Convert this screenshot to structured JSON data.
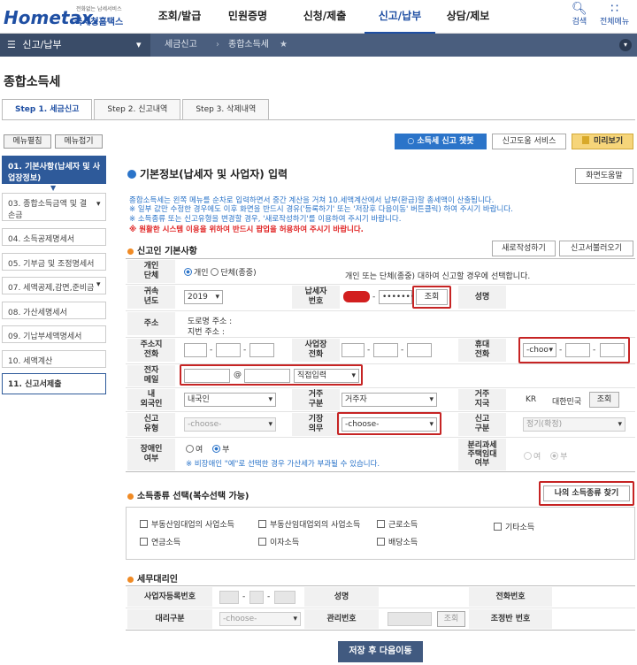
{
  "header": {
    "logo_brand": "Hometax.",
    "logo_sub": "국세청홈택스",
    "logo_tiny": "전화없는 납세서비스",
    "gnb": [
      "조회/발급",
      "민원증명",
      "신청/제출",
      "신고/납부",
      "상담/제보"
    ],
    "search_label": "검색",
    "allmenu_label": "전체메뉴"
  },
  "navbar": {
    "menu_label": "신고/납부",
    "crumb1": "세금신고",
    "crumb2": "종합소득세"
  },
  "page_title": "종합소득세",
  "steps": [
    "Step 1. 세금신고",
    "Step 2. 신고내역",
    "Step 3. 삭제내역"
  ],
  "side": {
    "expand_label": "메뉴펼침",
    "collapse_label": "메뉴접기",
    "items": [
      "01. 기본사항(납세자 및 사업장정보)",
      "03. 종합소득금액 및 결손금",
      "04. 소득공제명세서",
      "05. 기부금 및 조정명세서",
      "07. 세액공제,감면,준비금",
      "08. 가산세명세서",
      "09. 기납부세액명세서",
      "10. 세액계산",
      "11. 신고서제출"
    ]
  },
  "top_buttons": {
    "chatbot": "소득세 신고 챗봇",
    "help_service": "신고도움 서비스",
    "preview": "미리보기"
  },
  "main": {
    "title": "기본정보(납세자 및 사업자) 입력",
    "screen_help": "화면도움말",
    "notes": [
      "종합소득세는 왼쪽 메뉴를 순차로 입력하면서 중간 계산을 거쳐 10.세액계산에서 납부(환급)할 총세액이 산출됩니다.",
      "※ 일부 값만 수정한 경우에도 이후 화면을 반드시 경유('등록하기' 또는 '저장후 다음이동' 버튼클릭) 하여 주시기 바랍니다.",
      "※ 소득종류 또는 신고유형을 변경할 경우, '새로작성하기'를 이용하여 주시기 바랍니다."
    ],
    "note_red": "※ 원활한 시스템 이용을 위하여 반드시 팝업을 허용하여 주시기 바랍니다."
  },
  "basic": {
    "section_title": "신고인 기본사항",
    "new_write": "새로작성하기",
    "load_report": "신고서불러오기",
    "individual_label": "개인\n단체",
    "radio_individual": "개인",
    "radio_group": "단체(종중)",
    "individual_desc": "개인 또는 단체(종중) 대하여 신고할 경우에 선택합니다.",
    "year_label": "귀속\n년도",
    "year_value": "2019",
    "taxpayer_no_label": "납세자\n번호",
    "taxpayer_no_mask": "•••••••",
    "lookup": "조회",
    "name_label": "성명",
    "address_label": "주소",
    "road_address": "도로명 주소 :",
    "lot_address": "지번 주소 :",
    "home_phone_label": "주소지\n전화",
    "biz_phone_label": "사업장\n전화",
    "mobile_label": "휴대\n전화",
    "mobile_select": "-choo",
    "email_label": "전자\n메일",
    "email_at": "@",
    "email_select": "직접입력",
    "residence_label": "내\n외국인",
    "residence_value": "내국인",
    "resident_type_label": "거주\n구분",
    "resident_type_value": "거주자",
    "resident_country_label": "거주\n지국",
    "country_code": "KR",
    "country_name": "대한민국",
    "report_type_label": "신고\n유형",
    "report_type_value": "-choose-",
    "filing_duty_label": "기장\n의무",
    "filing_duty_value": "-choose-",
    "report_class_label": "신고\n구분",
    "report_class_value": "정기(확정)",
    "disabled_label": "장애인\n여부",
    "yes": "여",
    "no": "부",
    "disabled_note": "※ 비장애인 \"예\"로 선택한 경우 가산세가 부과될 수 있습니다.",
    "separate_label": "분리과세\n주택임대\n여부"
  },
  "income": {
    "section_title": "소득종류 선택(복수선택 가능)",
    "find_button": "나의 소득종류 찾기",
    "options": [
      "부동산임대업의 사업소득",
      "부동산임대업외의 사업소득",
      "근로소득",
      "기타소득",
      "연금소득",
      "이자소득",
      "배당소득"
    ]
  },
  "agent": {
    "section_title": "세무대리인",
    "biz_no_label": "사업자등록번호",
    "name_label": "성명",
    "phone_label": "전화번호",
    "type_label": "대리구분",
    "type_value": "-choose-",
    "manage_no_label": "관리번호",
    "lookup": "조회",
    "adjust_no_label": "조정반 번호"
  },
  "footer": {
    "save_next": "저장 후 다음이동"
  }
}
